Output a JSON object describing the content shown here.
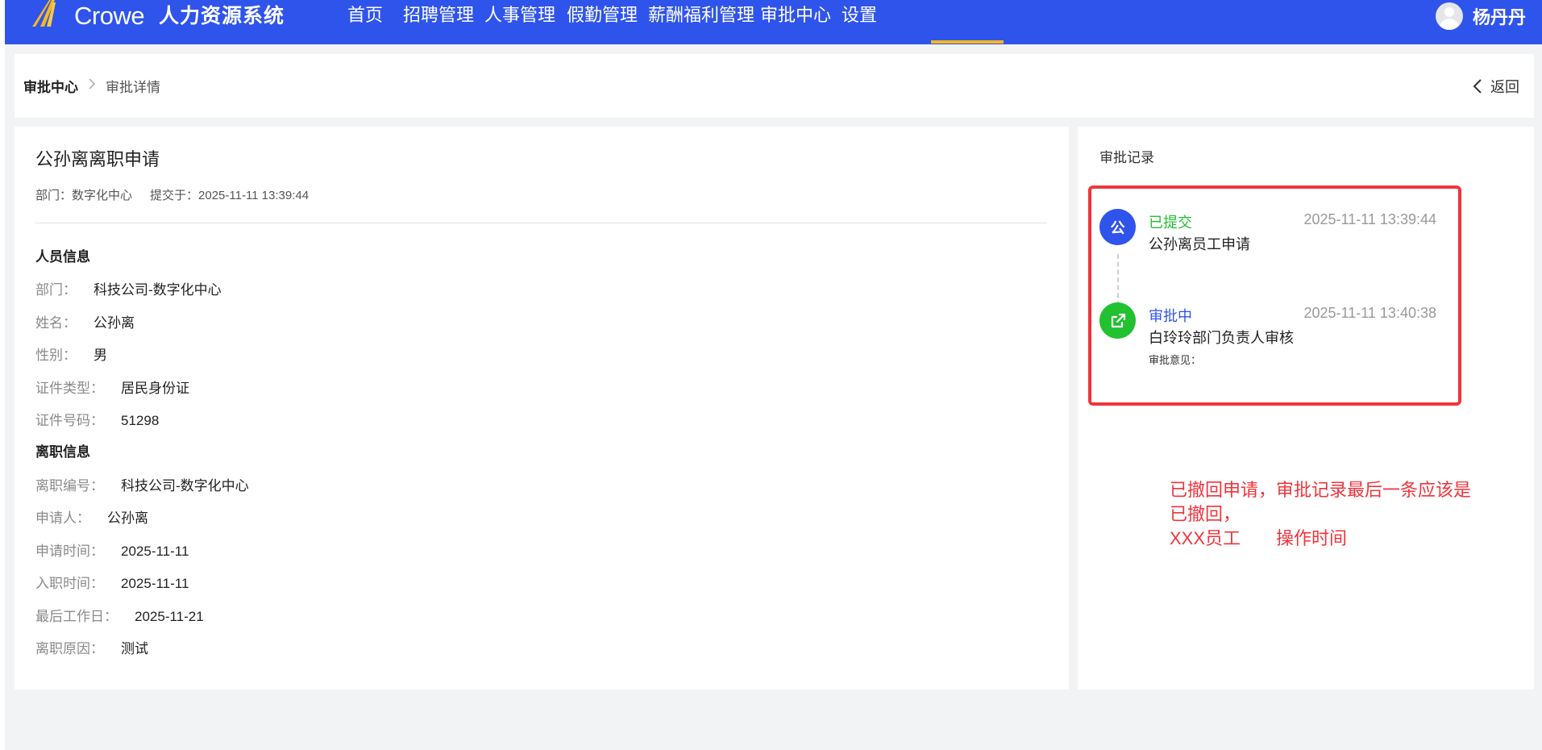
{
  "header": {
    "brand_name": "Crowe",
    "system_name": "人力资源系统",
    "nav": [
      {
        "label": "首页",
        "active": false
      },
      {
        "label": "招聘管理",
        "active": false
      },
      {
        "label": "人事管理",
        "active": false
      },
      {
        "label": "假勤管理",
        "active": false
      },
      {
        "label": "薪酬福利管理",
        "active": false
      },
      {
        "label": "审批中心",
        "active": true
      },
      {
        "label": "设置",
        "active": false
      }
    ],
    "username": "杨丹丹",
    "colors": {
      "bar": "#2f54eb",
      "active_underline": "#f5b820"
    }
  },
  "breadcrumb": {
    "root": "审批中心",
    "current": "审批详情",
    "back_label": "返回"
  },
  "detail": {
    "title": "公孙离离职申请",
    "department_meta": "部门：数字化中心",
    "submitted_meta": "提交于：2025-11-11 13:39:44",
    "personnel_section": "人员信息",
    "personnel": [
      {
        "label": "部门：",
        "value": "科技公司-数字化中心"
      },
      {
        "label": "姓名：",
        "value": "公孙离"
      },
      {
        "label": "性别：",
        "value": "男"
      },
      {
        "label": "证件类型：",
        "value": "居民身份证"
      },
      {
        "label": "证件号码：",
        "value": "51298"
      }
    ],
    "resignation_section": "离职信息",
    "resignation": [
      {
        "label": "离职编号：",
        "value": "科技公司-数字化中心"
      },
      {
        "label": "申请人：",
        "value": "公孙离"
      },
      {
        "label": "申请时间：",
        "value": "2025-11-11"
      },
      {
        "label": "入职时间：",
        "value": "2025-11-11"
      },
      {
        "label": "最后工作日：",
        "value": "2025-11-21"
      },
      {
        "label": "离职原因：",
        "value": "测试"
      }
    ]
  },
  "approval": {
    "title": "审批记录",
    "records": [
      {
        "avatar_text": "公",
        "status": "已提交",
        "status_color": "#21c130",
        "time": "2025-11-11 13:39:44",
        "desc": "公孙离员工申请",
        "icon": "submit-avatar"
      },
      {
        "avatar_text": "",
        "status": "审批中",
        "status_color": "#2f54eb",
        "time": "2025-11-11 13:40:38",
        "desc": "白玲玲部门负责人审核",
        "opinion": "审批意见：",
        "icon": "share-icon"
      }
    ]
  },
  "annotation": {
    "line1": "已撤回申请，审批记录最后一条应该是",
    "line2": "已撤回，",
    "line3": "XXX员工　　操作时间",
    "color": "#f0343c"
  }
}
